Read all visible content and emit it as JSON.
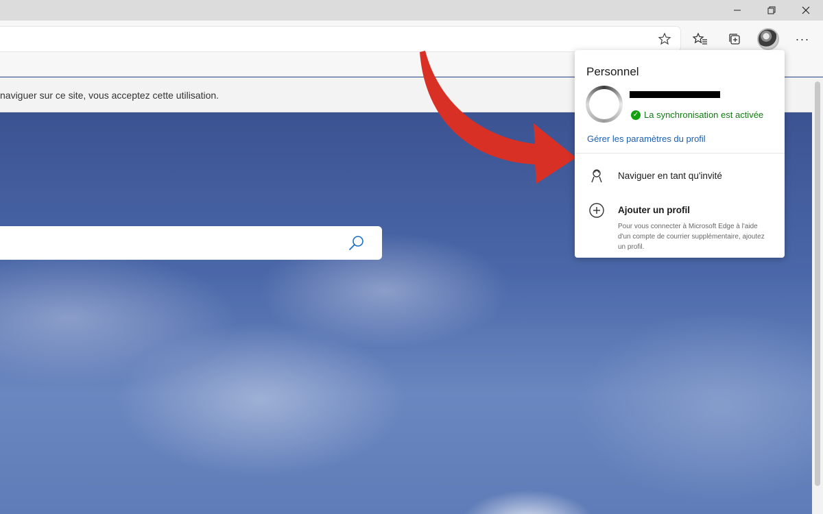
{
  "window": {
    "controls": [
      "minimize-icon",
      "restore-icon",
      "close-icon"
    ]
  },
  "toolbar": {
    "icons": [
      "star-icon",
      "favorites-icon",
      "collections-icon",
      "avatar",
      "more-icon"
    ],
    "more_label": "···"
  },
  "notice": {
    "text": "naviguer sur ce site, vous acceptez cette utilisation."
  },
  "search": {
    "icon": "search-icon"
  },
  "profile_flyout": {
    "title": "Personnel",
    "sync_status": "La synchronisation est activée",
    "manage_link": "Gérer les paramètres du profil",
    "guest_label": "Naviguer en tant qu'invité",
    "add_profile_label": "Ajouter un profil",
    "add_profile_desc": "Pour vous connecter à Microsoft Edge à l'aide d'un compte de courrier supplémentaire, ajoutez un profil."
  },
  "colors": {
    "sync_green": "#107c10",
    "link_blue": "#1a5fb4",
    "arrow_red": "#d93025"
  }
}
